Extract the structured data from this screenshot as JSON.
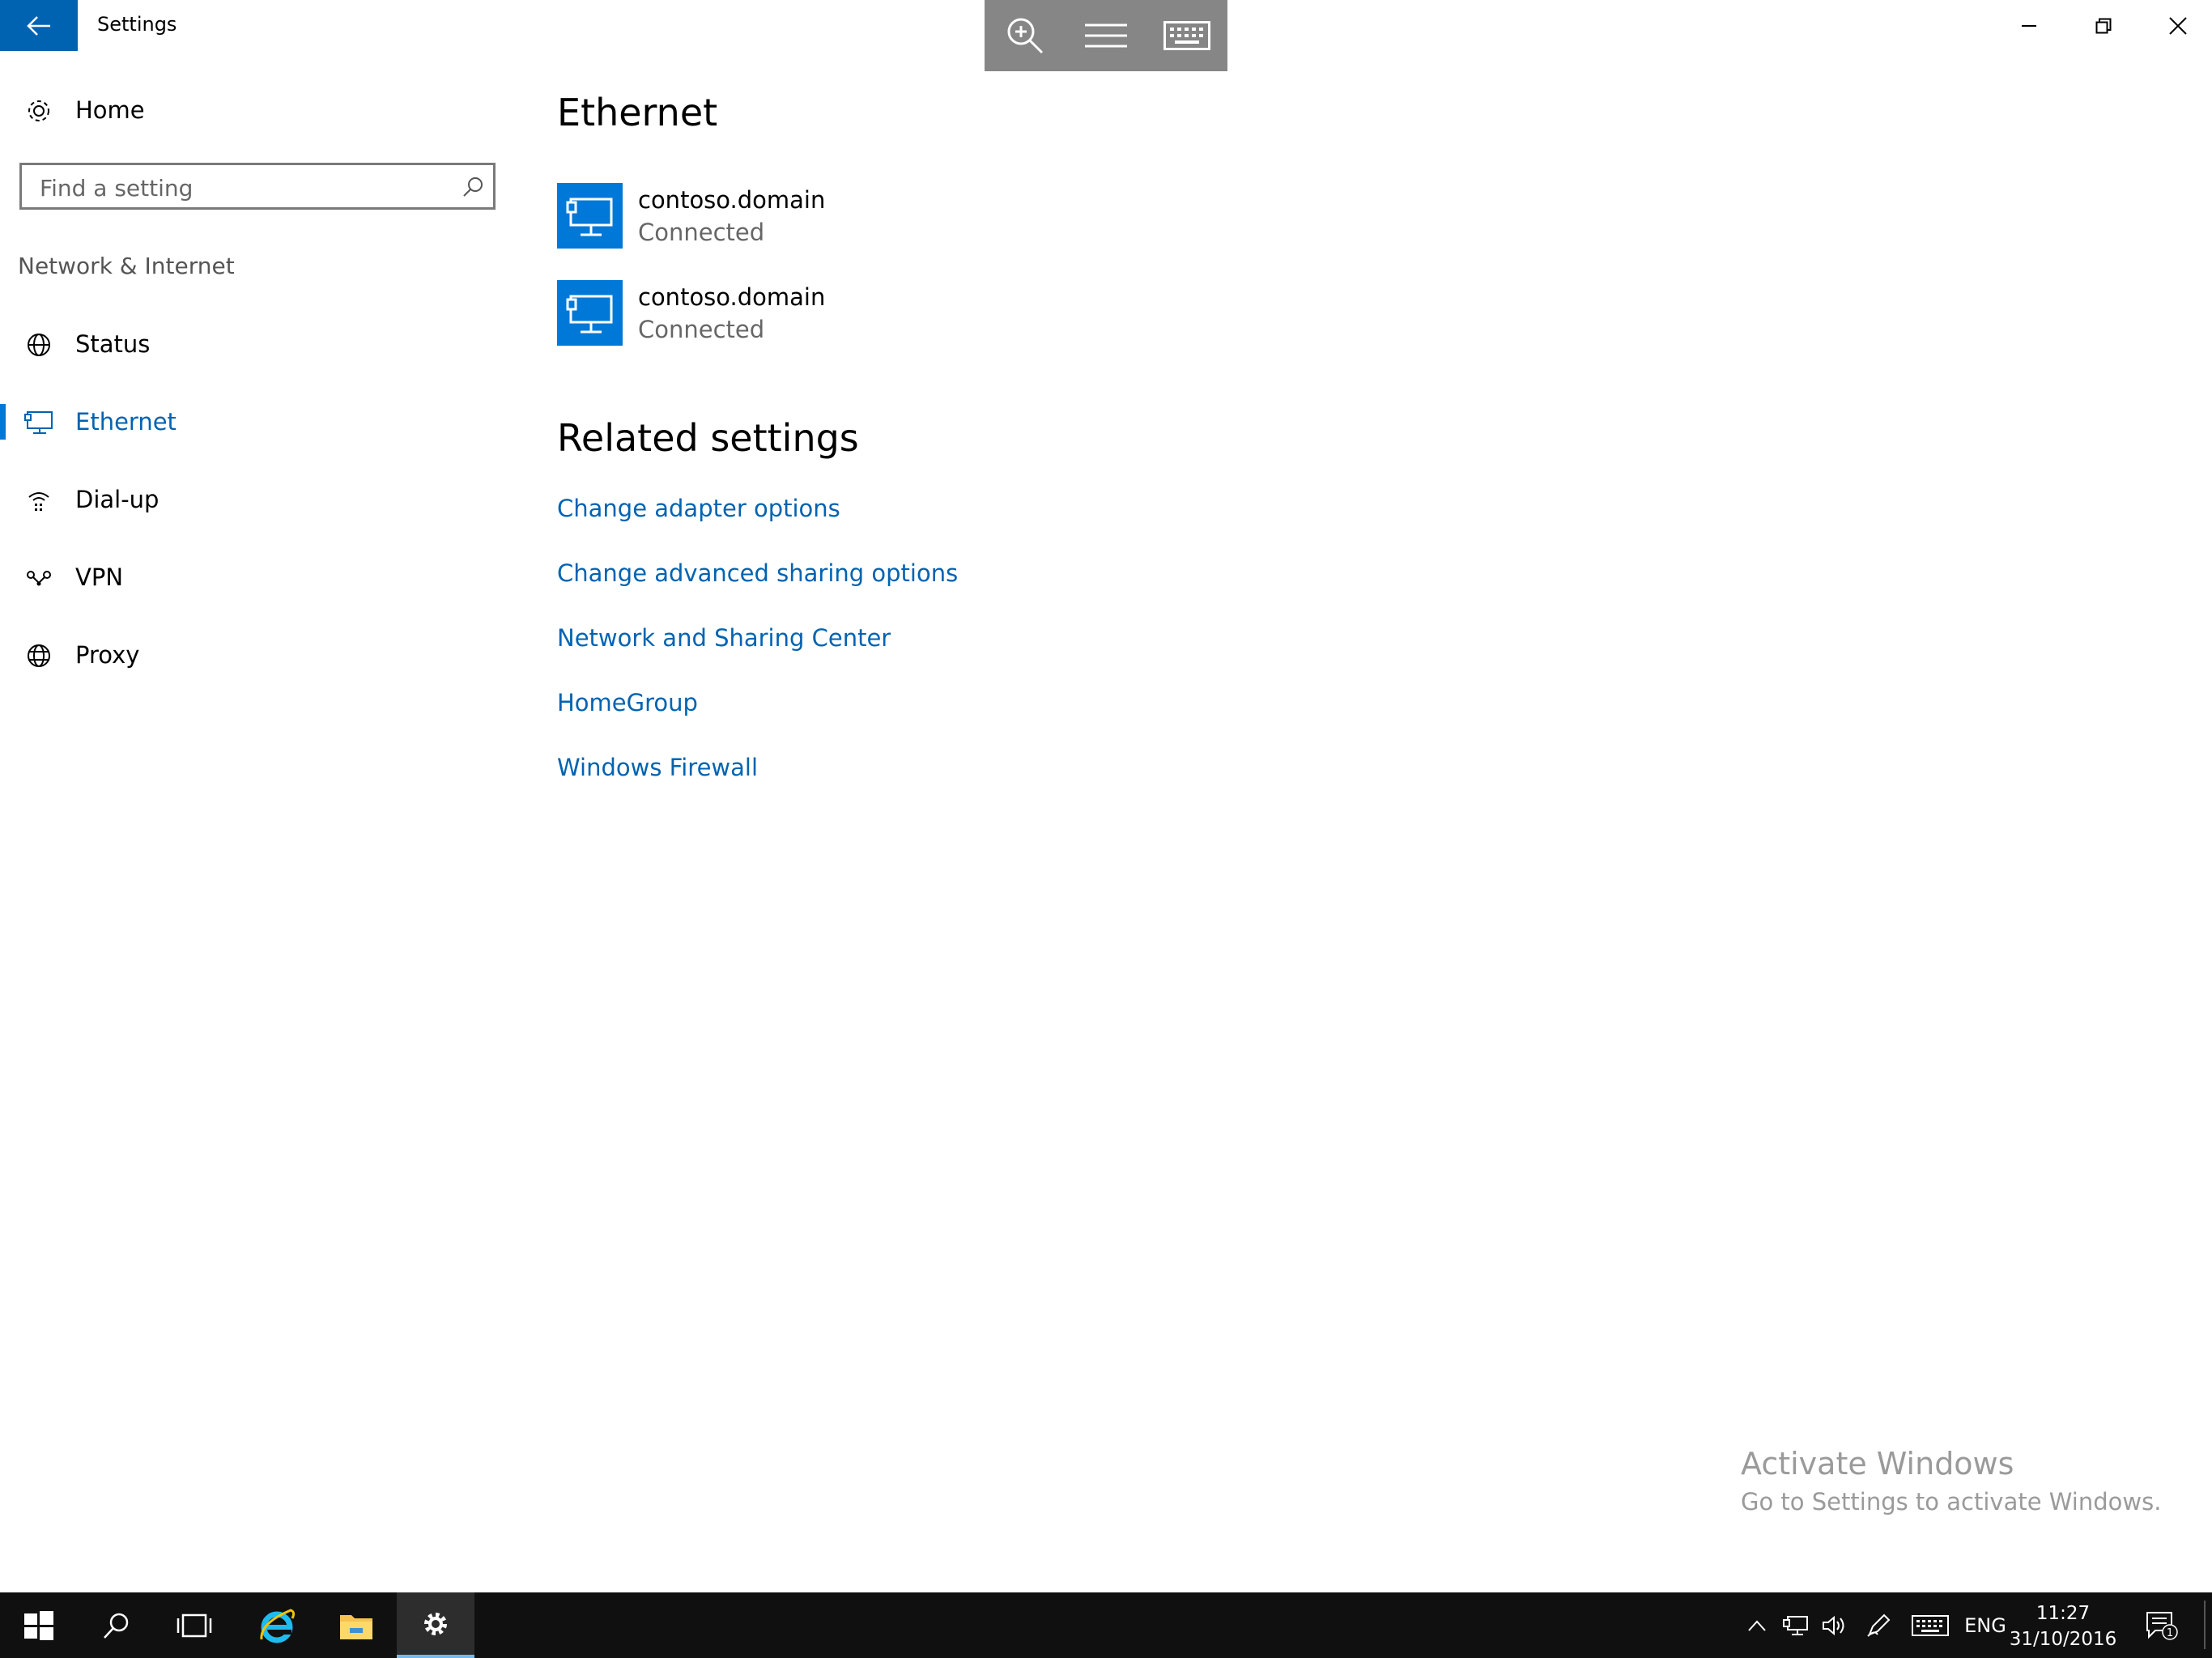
{
  "window": {
    "title": "Settings"
  },
  "sidebar": {
    "home_label": "Home",
    "search_placeholder": "Find a setting",
    "section_label": "Network & Internet",
    "items": [
      {
        "label": "Status",
        "icon": "globe-status-icon"
      },
      {
        "label": "Ethernet",
        "icon": "ethernet-icon",
        "selected": true
      },
      {
        "label": "Dial-up",
        "icon": "dialup-icon"
      },
      {
        "label": "VPN",
        "icon": "vpn-icon"
      },
      {
        "label": "Proxy",
        "icon": "globe-icon"
      }
    ]
  },
  "main": {
    "title": "Ethernet",
    "connections": [
      {
        "name": "contoso.domain",
        "status": "Connected"
      },
      {
        "name": "contoso.domain",
        "status": "Connected"
      }
    ],
    "related_title": "Related settings",
    "related_links": [
      "Change adapter options",
      "Change advanced sharing options",
      "Network and Sharing Center",
      "HomeGroup",
      "Windows Firewall"
    ]
  },
  "watermark": {
    "line1": "Activate Windows",
    "line2": "Go to Settings to activate Windows."
  },
  "taskbar": {
    "language": "ENG",
    "time": "11:27",
    "date": "31/10/2016",
    "notification_count": "1"
  },
  "colors": {
    "accent": "#0078d7",
    "accent_dark": "#0063b1",
    "taskbar": "#101010"
  }
}
